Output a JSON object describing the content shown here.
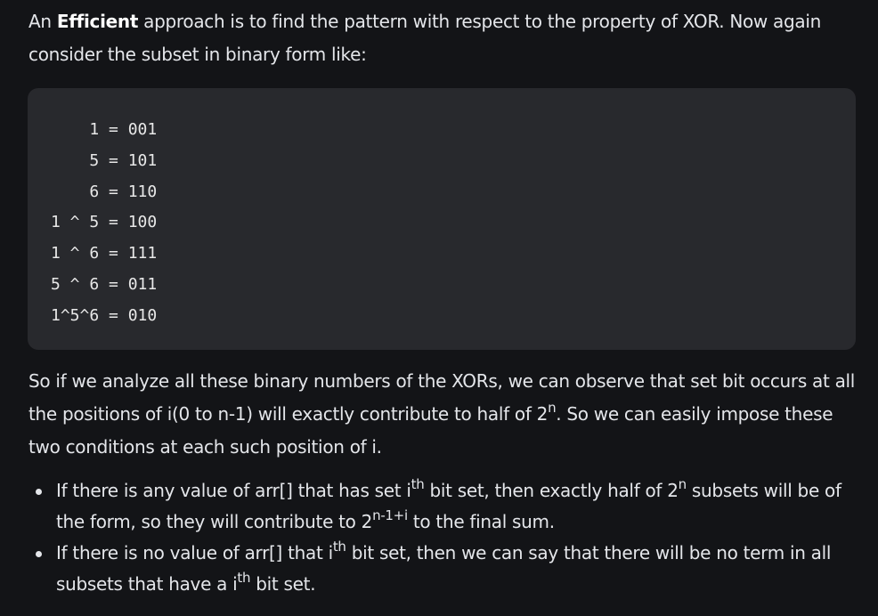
{
  "intro": {
    "pre": "An ",
    "bold": "Efficient",
    "post": " approach is to find the pattern with respect to the property of XOR. Now again consider the subset in binary form like:"
  },
  "code_lines": [
    "    1 = 001",
    "    5 = 101",
    "    6 = 110",
    "1 ^ 5 = 100",
    "1 ^ 6 = 111",
    "5 ^ 6 = 011",
    "1^5^6 = 010"
  ],
  "analysis": {
    "text": "So if we analyze all these binary numbers of the XORs, we can observe that set bit occurs at all the positions of i(0 to n-1) will exactly contribute to half of 2",
    "sup": "n",
    "tail": ". So we can easily impose these two conditions at each such position of i."
  },
  "bullets": [
    {
      "t1": "If there is any value of arr[] that has set i",
      "s1": "th",
      "t2": " bit set, then exactly half of 2",
      "s2": "n",
      "t3": " subsets will be of the form, so they will contribute to 2",
      "s3": "n-1+i",
      "t4": " to the final sum."
    },
    {
      "t1": "If there is no value of arr[] that i",
      "s1": "th",
      "t2": " bit set, then we can say that there will be no term in all subsets that have a i",
      "s2": "th",
      "t3": " bit set."
    }
  ]
}
